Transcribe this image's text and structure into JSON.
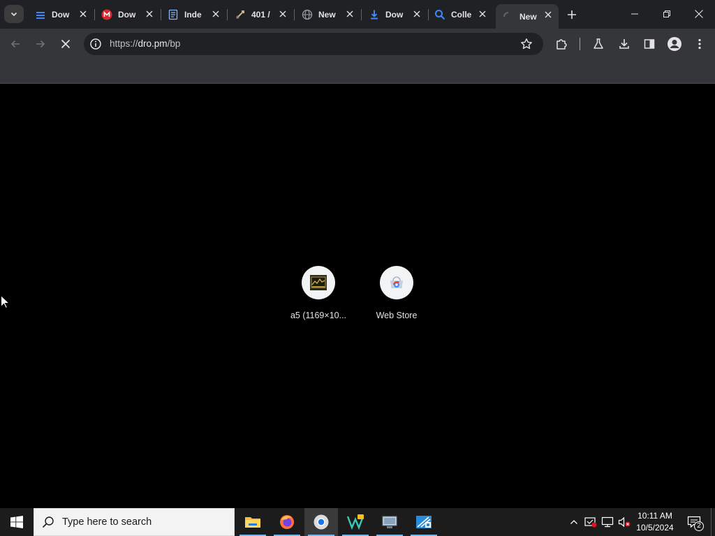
{
  "browser": {
    "tabs": [
      {
        "title": "Dow",
        "icon": "stack-favicon",
        "color": "#4285f4",
        "active": false
      },
      {
        "title": "Dow",
        "icon": "mega-favicon",
        "color": "#d9272e",
        "active": false
      },
      {
        "title": "Inde",
        "icon": "page-favicon",
        "color": "#8ab4f8",
        "active": false
      },
      {
        "title": "401 /",
        "icon": "sword-favicon",
        "color": "#c8b38a",
        "active": false
      },
      {
        "title": "New",
        "icon": "globe-favicon",
        "color": "#9aa0a6",
        "active": false
      },
      {
        "title": "Dow",
        "icon": "download-favicon",
        "color": "#4285f4",
        "active": false
      },
      {
        "title": "Colle",
        "icon": "search-favicon",
        "color": "#4285f4",
        "active": false
      },
      {
        "title": "New",
        "icon": "loading-spinner-icon",
        "color": "#9aa0a6",
        "active": true
      }
    ],
    "address_bar": {
      "scheme": "https://",
      "host": "dro.pm",
      "path": "/bp"
    }
  },
  "new_tab": {
    "shortcuts": [
      {
        "label": "a5 (1169×10...",
        "icon": "image-thumbnail-icon"
      },
      {
        "label": "Web Store",
        "icon": "web-store-icon"
      }
    ]
  },
  "taskbar": {
    "search_placeholder": "Type here to search",
    "apps": [
      "file-explorer-icon",
      "firefox-icon",
      "chrome-icon",
      "visual-studio-icon",
      "network-app-icon",
      "remote-app-icon"
    ],
    "clock": {
      "time": "10:11 AM",
      "date": "10/5/2024"
    },
    "notification_count": "2"
  },
  "colors": {
    "tab_strip": "#202124",
    "toolbar": "#35363a",
    "omnibox": "#202124",
    "content_bg": "#000000",
    "taskbar": "#1c1c1c",
    "search_box": "#f3f3f3",
    "accent": "#76b9ed"
  }
}
